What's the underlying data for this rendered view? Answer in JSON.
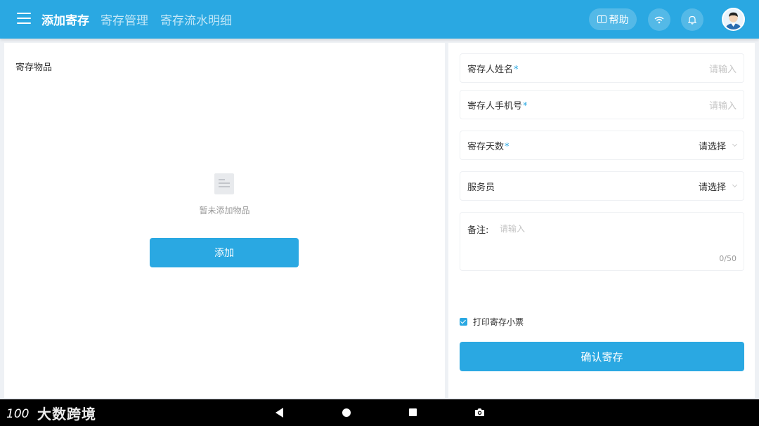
{
  "header": {
    "tabs": [
      {
        "label": "添加寄存",
        "active": true
      },
      {
        "label": "寄存管理",
        "active": false
      },
      {
        "label": "寄存流水明细",
        "active": false
      }
    ],
    "help_label": "帮助"
  },
  "left_panel": {
    "title": "寄存物品",
    "empty_text": "暂未添加物品",
    "add_button": "添加"
  },
  "form": {
    "fields": [
      {
        "label": "寄存人姓名",
        "required_mark": "*",
        "value": "请输入"
      },
      {
        "label": "寄存人手机号",
        "required_mark": "*",
        "value": "请输入"
      },
      {
        "label": "寄存天数",
        "required_mark": "*",
        "value": "请选择"
      },
      {
        "label": "服务员",
        "value": "请选择"
      }
    ],
    "remark": {
      "label": "备注:",
      "placeholder": "请输入",
      "count": "0/50"
    },
    "print_ticket": {
      "label": "打印寄存小票",
      "checked": true
    },
    "confirm_button": "确认寄存"
  },
  "watermark": {
    "text": "大数跨境",
    "logo": "100"
  },
  "colors": {
    "accent": "#2aa8e2",
    "background": "#eef1f5"
  }
}
